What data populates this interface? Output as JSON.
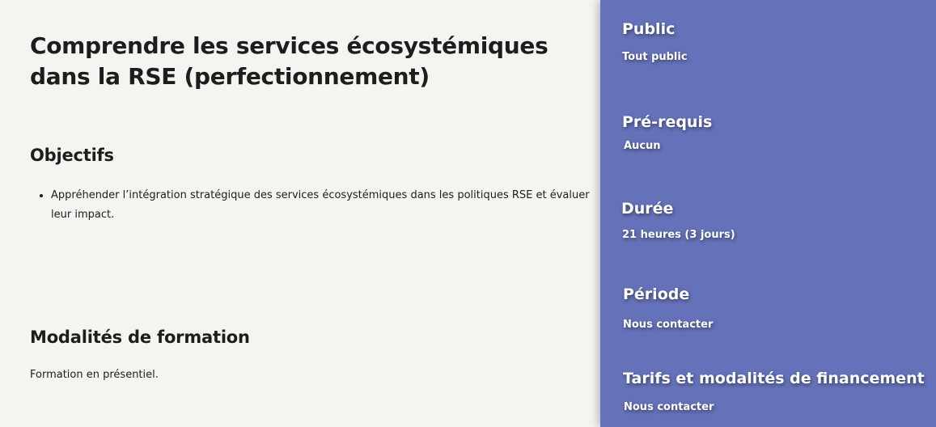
{
  "main": {
    "title": "Comprendre les services écosystémiques dans la RSE (perfectionnement)",
    "objectives": {
      "heading": "Objectifs",
      "items": [
        "Appréhender l’intégration stratégique des services écosystémiques dans les politiques RSE et évaluer leur impact."
      ]
    },
    "modalities": {
      "heading": "Modalités de formation",
      "text": "Formation en présentiel."
    }
  },
  "sidebar": {
    "public": {
      "label": "Public",
      "value": "Tout public"
    },
    "prerequisites": {
      "label": "Pré-requis",
      "value": "Aucun"
    },
    "duration": {
      "label": "Durée",
      "value": "21 heures (3 jours)"
    },
    "period": {
      "label": "Période",
      "value": "Nous contacter"
    },
    "pricing": {
      "label": "Tarifs et modalités de financement",
      "value": "Nous contacter"
    }
  },
  "colors": {
    "page_background": "#f6f4f1",
    "sidebar_background": "#6571b8",
    "text_dark": "#1d1d1b",
    "text_light": "#ffffff"
  }
}
